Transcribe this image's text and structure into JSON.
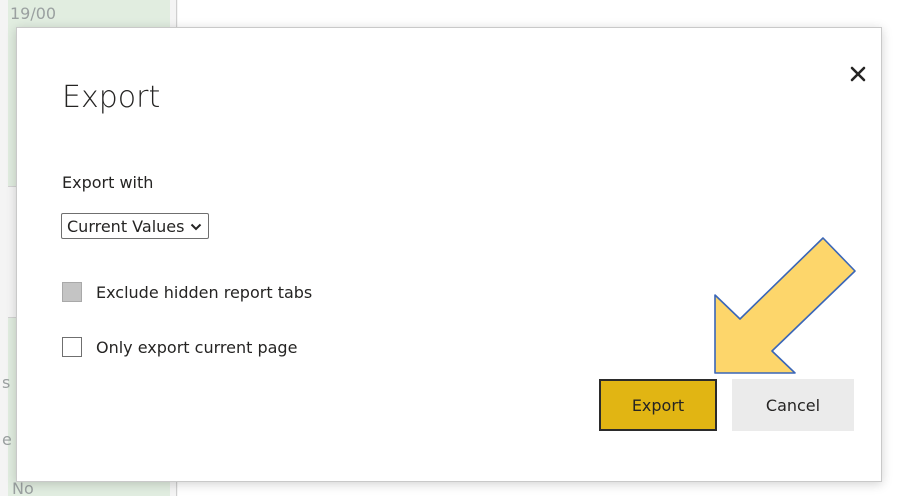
{
  "background": {
    "fragments": [
      "19/00",
      "s",
      "e",
      "No"
    ]
  },
  "dialog": {
    "title": "Export",
    "close_icon": "close-icon",
    "export_with_label": "Export with",
    "export_with_select": {
      "selected": "Current Values",
      "icon": "chevron-down-icon"
    },
    "options": [
      {
        "label": "Exclude hidden report tabs",
        "checked": false,
        "disabled": true
      },
      {
        "label": "Only export current page",
        "checked": false,
        "disabled": false
      }
    ],
    "buttons": {
      "export_label": "Export",
      "cancel_label": "Cancel"
    },
    "accent_color": "#e1b513"
  },
  "annotation": {
    "arrow_color": "#fdd66b",
    "arrow_outline": "#3a66b8"
  }
}
